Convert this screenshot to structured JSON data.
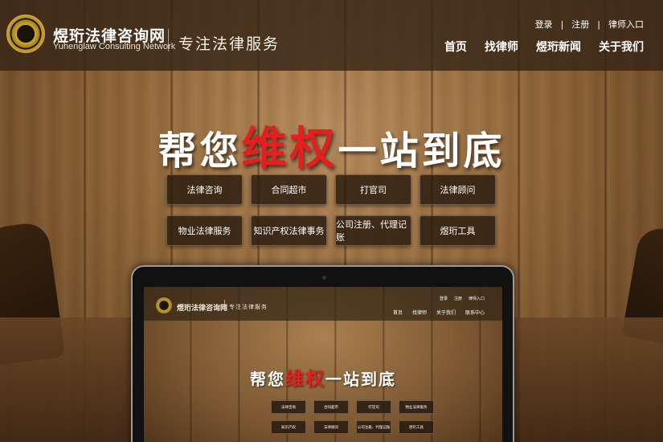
{
  "header": {
    "site_name": "煜珩法律咨询网",
    "site_name_en": "Yuhenglaw Consulting Network",
    "slogan": "专注法律服务",
    "top_links": [
      "登录",
      "注册",
      "律师入口"
    ],
    "nav": [
      "首页",
      "找律师",
      "煜珩新闻",
      "关于我们"
    ]
  },
  "hero": {
    "title_pre": "帮您",
    "title_highlight": "维权",
    "title_post": "一站到底",
    "highlight_color": "#e41f1f"
  },
  "services": [
    "法律咨询",
    "合同超市",
    "打官司",
    "法律顾问",
    "物业法律服务",
    "知识产权法律事务",
    "公司注册、代理记账",
    "煜珩工具"
  ],
  "laptop_screen": {
    "site_name": "煜珩法律咨询网",
    "slogan": "专注法律服务",
    "top_links": [
      "登录",
      "注册",
      "律师入口"
    ],
    "nav": [
      "首页",
      "找律师",
      "关于我们",
      "联系中心"
    ],
    "title_pre": "帮您",
    "title_highlight": "维权",
    "title_post": "一站到底",
    "services": [
      "法律咨询",
      "合同超市",
      "打官司",
      "物业法律服务",
      "知识产权",
      "法律顾问",
      "公司注册、代理记账",
      "煜珩工具"
    ]
  }
}
